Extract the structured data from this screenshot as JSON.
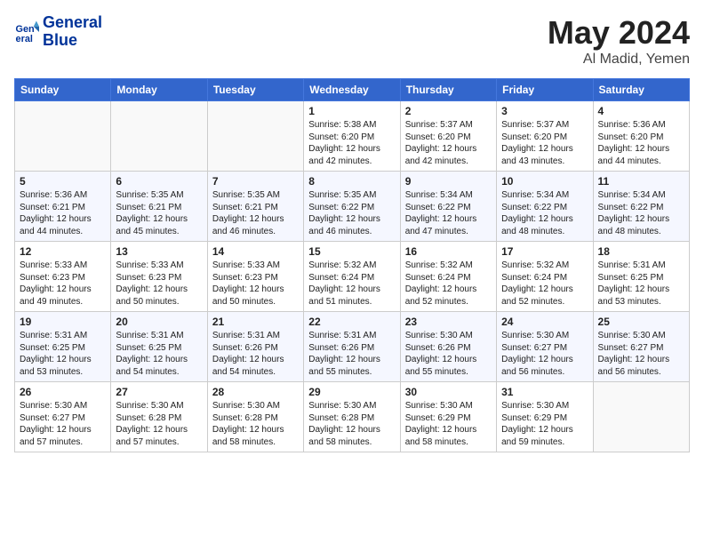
{
  "header": {
    "logo_line1": "General",
    "logo_line2": "Blue",
    "title": "May 2024",
    "location": "Al Madid, Yemen"
  },
  "weekdays": [
    "Sunday",
    "Monday",
    "Tuesday",
    "Wednesday",
    "Thursday",
    "Friday",
    "Saturday"
  ],
  "weeks": [
    [
      {
        "day": "",
        "sunrise": "",
        "sunset": "",
        "daylight": ""
      },
      {
        "day": "",
        "sunrise": "",
        "sunset": "",
        "daylight": ""
      },
      {
        "day": "",
        "sunrise": "",
        "sunset": "",
        "daylight": ""
      },
      {
        "day": "1",
        "sunrise": "Sunrise: 5:38 AM",
        "sunset": "Sunset: 6:20 PM",
        "daylight": "Daylight: 12 hours and 42 minutes."
      },
      {
        "day": "2",
        "sunrise": "Sunrise: 5:37 AM",
        "sunset": "Sunset: 6:20 PM",
        "daylight": "Daylight: 12 hours and 42 minutes."
      },
      {
        "day": "3",
        "sunrise": "Sunrise: 5:37 AM",
        "sunset": "Sunset: 6:20 PM",
        "daylight": "Daylight: 12 hours and 43 minutes."
      },
      {
        "day": "4",
        "sunrise": "Sunrise: 5:36 AM",
        "sunset": "Sunset: 6:20 PM",
        "daylight": "Daylight: 12 hours and 44 minutes."
      }
    ],
    [
      {
        "day": "5",
        "sunrise": "Sunrise: 5:36 AM",
        "sunset": "Sunset: 6:21 PM",
        "daylight": "Daylight: 12 hours and 44 minutes."
      },
      {
        "day": "6",
        "sunrise": "Sunrise: 5:35 AM",
        "sunset": "Sunset: 6:21 PM",
        "daylight": "Daylight: 12 hours and 45 minutes."
      },
      {
        "day": "7",
        "sunrise": "Sunrise: 5:35 AM",
        "sunset": "Sunset: 6:21 PM",
        "daylight": "Daylight: 12 hours and 46 minutes."
      },
      {
        "day": "8",
        "sunrise": "Sunrise: 5:35 AM",
        "sunset": "Sunset: 6:22 PM",
        "daylight": "Daylight: 12 hours and 46 minutes."
      },
      {
        "day": "9",
        "sunrise": "Sunrise: 5:34 AM",
        "sunset": "Sunset: 6:22 PM",
        "daylight": "Daylight: 12 hours and 47 minutes."
      },
      {
        "day": "10",
        "sunrise": "Sunrise: 5:34 AM",
        "sunset": "Sunset: 6:22 PM",
        "daylight": "Daylight: 12 hours and 48 minutes."
      },
      {
        "day": "11",
        "sunrise": "Sunrise: 5:34 AM",
        "sunset": "Sunset: 6:22 PM",
        "daylight": "Daylight: 12 hours and 48 minutes."
      }
    ],
    [
      {
        "day": "12",
        "sunrise": "Sunrise: 5:33 AM",
        "sunset": "Sunset: 6:23 PM",
        "daylight": "Daylight: 12 hours and 49 minutes."
      },
      {
        "day": "13",
        "sunrise": "Sunrise: 5:33 AM",
        "sunset": "Sunset: 6:23 PM",
        "daylight": "Daylight: 12 hours and 50 minutes."
      },
      {
        "day": "14",
        "sunrise": "Sunrise: 5:33 AM",
        "sunset": "Sunset: 6:23 PM",
        "daylight": "Daylight: 12 hours and 50 minutes."
      },
      {
        "day": "15",
        "sunrise": "Sunrise: 5:32 AM",
        "sunset": "Sunset: 6:24 PM",
        "daylight": "Daylight: 12 hours and 51 minutes."
      },
      {
        "day": "16",
        "sunrise": "Sunrise: 5:32 AM",
        "sunset": "Sunset: 6:24 PM",
        "daylight": "Daylight: 12 hours and 52 minutes."
      },
      {
        "day": "17",
        "sunrise": "Sunrise: 5:32 AM",
        "sunset": "Sunset: 6:24 PM",
        "daylight": "Daylight: 12 hours and 52 minutes."
      },
      {
        "day": "18",
        "sunrise": "Sunrise: 5:31 AM",
        "sunset": "Sunset: 6:25 PM",
        "daylight": "Daylight: 12 hours and 53 minutes."
      }
    ],
    [
      {
        "day": "19",
        "sunrise": "Sunrise: 5:31 AM",
        "sunset": "Sunset: 6:25 PM",
        "daylight": "Daylight: 12 hours and 53 minutes."
      },
      {
        "day": "20",
        "sunrise": "Sunrise: 5:31 AM",
        "sunset": "Sunset: 6:25 PM",
        "daylight": "Daylight: 12 hours and 54 minutes."
      },
      {
        "day": "21",
        "sunrise": "Sunrise: 5:31 AM",
        "sunset": "Sunset: 6:26 PM",
        "daylight": "Daylight: 12 hours and 54 minutes."
      },
      {
        "day": "22",
        "sunrise": "Sunrise: 5:31 AM",
        "sunset": "Sunset: 6:26 PM",
        "daylight": "Daylight: 12 hours and 55 minutes."
      },
      {
        "day": "23",
        "sunrise": "Sunrise: 5:30 AM",
        "sunset": "Sunset: 6:26 PM",
        "daylight": "Daylight: 12 hours and 55 minutes."
      },
      {
        "day": "24",
        "sunrise": "Sunrise: 5:30 AM",
        "sunset": "Sunset: 6:27 PM",
        "daylight": "Daylight: 12 hours and 56 minutes."
      },
      {
        "day": "25",
        "sunrise": "Sunrise: 5:30 AM",
        "sunset": "Sunset: 6:27 PM",
        "daylight": "Daylight: 12 hours and 56 minutes."
      }
    ],
    [
      {
        "day": "26",
        "sunrise": "Sunrise: 5:30 AM",
        "sunset": "Sunset: 6:27 PM",
        "daylight": "Daylight: 12 hours and 57 minutes."
      },
      {
        "day": "27",
        "sunrise": "Sunrise: 5:30 AM",
        "sunset": "Sunset: 6:28 PM",
        "daylight": "Daylight: 12 hours and 57 minutes."
      },
      {
        "day": "28",
        "sunrise": "Sunrise: 5:30 AM",
        "sunset": "Sunset: 6:28 PM",
        "daylight": "Daylight: 12 hours and 58 minutes."
      },
      {
        "day": "29",
        "sunrise": "Sunrise: 5:30 AM",
        "sunset": "Sunset: 6:28 PM",
        "daylight": "Daylight: 12 hours and 58 minutes."
      },
      {
        "day": "30",
        "sunrise": "Sunrise: 5:30 AM",
        "sunset": "Sunset: 6:29 PM",
        "daylight": "Daylight: 12 hours and 58 minutes."
      },
      {
        "day": "31",
        "sunrise": "Sunrise: 5:30 AM",
        "sunset": "Sunset: 6:29 PM",
        "daylight": "Daylight: 12 hours and 59 minutes."
      },
      {
        "day": "",
        "sunrise": "",
        "sunset": "",
        "daylight": ""
      }
    ]
  ]
}
